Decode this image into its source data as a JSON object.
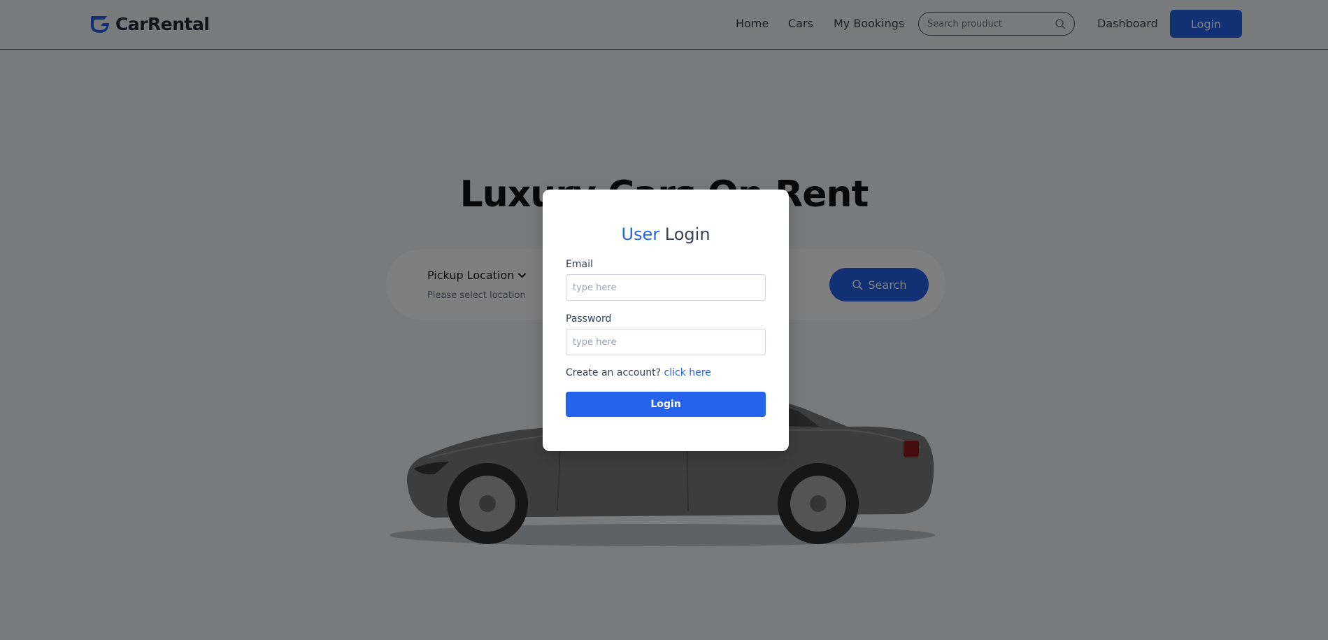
{
  "brand": {
    "name": "CarRental",
    "accent_color": "#2563eb",
    "logo_icon": "logo-icon"
  },
  "nav": {
    "items": [
      {
        "label": "Home"
      },
      {
        "label": "Cars"
      },
      {
        "label": "My Bookings"
      }
    ],
    "search_placeholder": "Search prouduct",
    "dashboard_label": "Dashboard",
    "login_label": "Login"
  },
  "hero": {
    "title": "Luxury Cars On Rent",
    "pickup_label": "Pickup Location",
    "pickup_placeholder": "Please select location",
    "search_label": "Search"
  },
  "modal": {
    "title_accent": "User",
    "title_rest": "Login",
    "email_label": "Email",
    "email_placeholder": "type here",
    "password_label": "Password",
    "password_placeholder": "type here",
    "create_account_text": "Create an account?",
    "create_account_link": "click here",
    "login_button": "Login"
  }
}
